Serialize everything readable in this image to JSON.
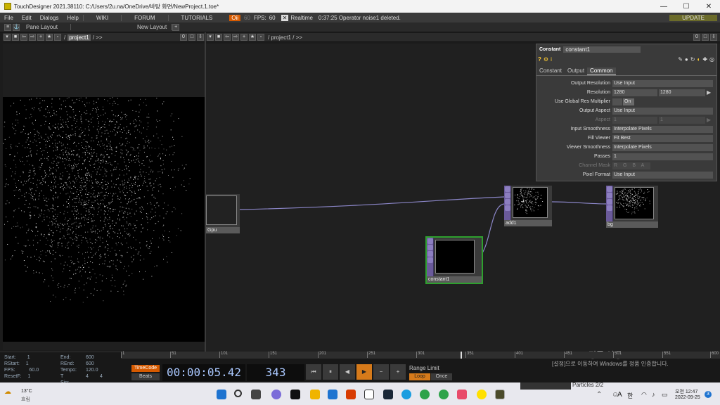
{
  "window": {
    "title": "TouchDesigner 2021.38110: C:/Users/2u.na/OneDrive/바탕 화면/NewProject.1.toe*",
    "min": "—",
    "max": "☐",
    "close": "✕"
  },
  "menu": {
    "items": [
      "File",
      "Edit",
      "Dialogs",
      "Help"
    ],
    "links": [
      "WIKI",
      "FORUM",
      "TUTORIALS"
    ],
    "oi": "Oii",
    "fps_cap": "60",
    "fps_label": "FPS:",
    "fps_value": "60",
    "realtime_x": "✕",
    "realtime": "Realtime",
    "status": "0:37:25 Operator noise1 deleted.",
    "update": "UPDATE"
  },
  "panebar": {
    "pane_layout": "Pane Layout",
    "new_layout": "New Layout",
    "plus": "+"
  },
  "left_path": {
    "current": "project1",
    "tail": "/ >>",
    "zero": "0"
  },
  "right_path": {
    "path": "/ project1 / >>",
    "zero": "0"
  },
  "nodes": [
    {
      "label": "Gpu"
    },
    {
      "label": "add1"
    },
    {
      "label": "bg"
    },
    {
      "label": "constant1"
    }
  ],
  "params": {
    "type": "Constant",
    "name": "constant1",
    "tabs": [
      "Constant",
      "Output",
      "Common"
    ],
    "rows": [
      {
        "label": "Output Resolution",
        "value": "Use Input"
      },
      {
        "label": "Resolution",
        "v1": "1280",
        "v2": "1280"
      },
      {
        "label": "Use Global Res Multiplier",
        "value": "On"
      },
      {
        "label": "Output Aspect",
        "value": "Use Input"
      },
      {
        "label": "Aspect",
        "v1": "1",
        "v2": "1"
      },
      {
        "label": "Input Smoothness",
        "value": "Interpolate Pixels"
      },
      {
        "label": "Fill Viewer",
        "value": "Fit Best"
      },
      {
        "label": "Viewer Smoothness",
        "value": "Interpolate Pixels"
      },
      {
        "label": "Passes",
        "value": "1"
      },
      {
        "label": "Channel Mask",
        "value": "R G B A"
      },
      {
        "label": "Pixel Format",
        "value": "Use Input"
      }
    ]
  },
  "timeline": {
    "start_l": "Start:",
    "start": "1",
    "end_l": "End:",
    "end": "600",
    "rstart_l": "RStart:",
    "rstart": "1",
    "rend_l": "REnd:",
    "rend": "600",
    "fps_l": "FPS:",
    "fps": "60.0",
    "tempo_l": "Tempo:",
    "tempo": "120.0",
    "resetf_l": "ResetF:",
    "resetf": "1",
    "tsig_l": "T Sig:",
    "tsig_a": "4",
    "tsig_b": "4",
    "timecode": "TimeCode",
    "beats": "Beats",
    "time": "00:00:05.42",
    "frame": "343",
    "range_limit": "Range Limit",
    "loop": "Loop",
    "once": "Once",
    "ticks": [
      "1",
      "51",
      "101",
      "151",
      "201",
      "251",
      "301",
      "351",
      "401",
      "451",
      "501",
      "551",
      "600"
    ],
    "watermark1": "Windows 정품 인증",
    "watermark2": "[설정]으로 이동하여 Windows를 정품 인증합니다."
  },
  "taskbar": {
    "weather_temp": "13°C",
    "weather_desc": "흐림",
    "time": "오전 12:47",
    "date": "2022-09-25",
    "lang": "한",
    "lang2": "A",
    "news": "Particles 2/2",
    "badge": "3"
  }
}
